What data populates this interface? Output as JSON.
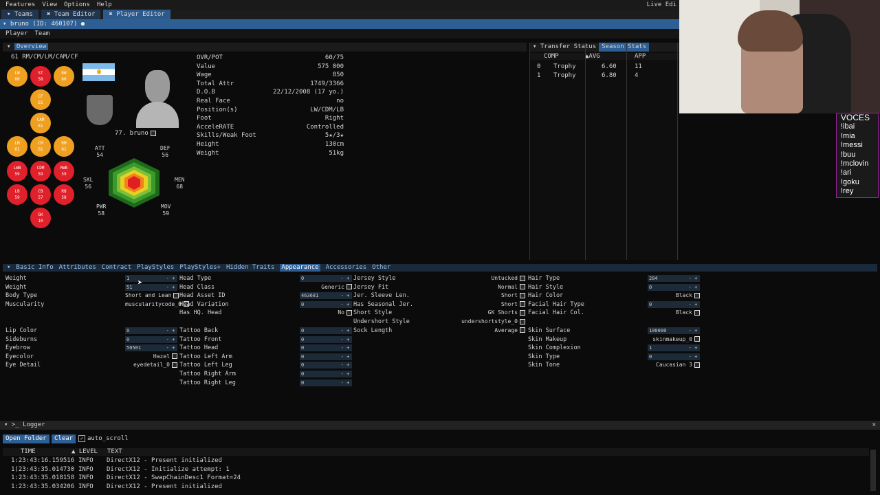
{
  "menu": [
    "Features",
    "View",
    "Options",
    "Help"
  ],
  "menu_right": "Live Edi",
  "tabs": [
    "Teams",
    "Team Editor",
    "Player Editor"
  ],
  "player_bar": "bruno (ID: 460107) ●",
  "subtabs": [
    "Player",
    "Team"
  ],
  "overview": {
    "title": "Overview",
    "positions_line": "61 RM/CM/LM/CAM/CF",
    "positions": [
      {
        "name": "LW",
        "val": "60",
        "color": "o"
      },
      {
        "name": "ST",
        "val": "58",
        "color": "r"
      },
      {
        "name": "RW",
        "val": "60",
        "color": "o"
      },
      {
        "name": "CF",
        "val": "61",
        "color": "o"
      },
      {
        "name": "CAM",
        "val": "61",
        "color": "o"
      },
      {
        "name": "LM",
        "val": "61",
        "color": "o"
      },
      {
        "name": "CM",
        "val": "61",
        "color": "o"
      },
      {
        "name": "RM",
        "val": "61",
        "color": "o"
      },
      {
        "name": "LWB",
        "val": "59",
        "color": "r"
      },
      {
        "name": "CDM",
        "val": "59",
        "color": "r"
      },
      {
        "name": "RWB",
        "val": "59",
        "color": "r"
      },
      {
        "name": "LB",
        "val": "59",
        "color": "r"
      },
      {
        "name": "CB",
        "val": "57",
        "color": "r"
      },
      {
        "name": "RB",
        "val": "58",
        "color": "r"
      },
      {
        "name": "GK",
        "val": "10",
        "color": "r"
      }
    ],
    "player_name": "77. bruno",
    "stats": {
      "att_l": "ATT",
      "att": "54",
      "def_l": "DEF",
      "def": "56",
      "skl_l": "SKL",
      "skl": "56",
      "men_l": "MEN",
      "men": "68",
      "pwr_l": "PWR",
      "pwr": "58",
      "mov_l": "MOV",
      "mov": "59"
    },
    "info": [
      [
        "OVR/POT",
        "60/75"
      ],
      [
        "Value",
        "575 000"
      ],
      [
        "Wage",
        "850"
      ],
      [
        "Total Attr",
        "1749/3366"
      ],
      [
        "D.O.B",
        "22/12/2008 (17 yo.)"
      ],
      [
        "Real Face",
        "no"
      ],
      [
        "Position(s)",
        "LW/CDM/LB"
      ],
      [
        "Foot",
        "Right"
      ],
      [
        "AcceleRATE",
        "Controlled"
      ],
      [
        "Skills/Weak Foot",
        "5★/3★"
      ],
      [
        "Height",
        "130cm"
      ],
      [
        "Weight",
        "51kg"
      ]
    ]
  },
  "transfer": {
    "tabs": [
      "Transfer Status",
      "Season Stats"
    ],
    "cols": [
      "COMP",
      "AVG",
      "APP"
    ],
    "rows": [
      [
        "0",
        "Trophy",
        "6.60",
        "11"
      ],
      [
        "1",
        "Trophy",
        "6.80",
        "4"
      ]
    ]
  },
  "editor_tabs": [
    "Basic Info",
    "Attributes",
    "Contract",
    "PlayStyles",
    "PlayStyles+",
    "Hidden Traits",
    "Appearance",
    "Accessories",
    "Other"
  ],
  "col1": [
    [
      "Weight",
      "1"
    ],
    [
      "Weight",
      "51"
    ],
    [
      "Body Type",
      "Short and Lean"
    ],
    [
      "Muscularity",
      "muscularitycode_0"
    ]
  ],
  "col1b": [
    [
      "Lip Color",
      "0"
    ],
    [
      "Sideburns",
      "0"
    ],
    [
      "Eyebrow",
      "50501"
    ],
    [
      "Eyecolor",
      "Hazel"
    ],
    [
      "Eye Detail",
      "eyedetail_0"
    ]
  ],
  "col2": [
    [
      "Head Type",
      "0"
    ],
    [
      "Head Class",
      "Generic"
    ],
    [
      "Head Asset ID",
      "463681"
    ],
    [
      "Head Variation",
      "0"
    ],
    [
      "Has HQ. Head",
      "No"
    ]
  ],
  "col2b": [
    [
      "Tattoo Back",
      "0"
    ],
    [
      "Tattoo Front",
      "0"
    ],
    [
      "Tattoo Head",
      "0"
    ],
    [
      "Tattoo Left Arm",
      "0"
    ],
    [
      "Tattoo Left Leg",
      "0"
    ],
    [
      "Tattoo Right Arm",
      "0"
    ],
    [
      "Tattoo Right Leg",
      "0"
    ]
  ],
  "col3": [
    [
      "Jersey Style",
      "Untucked"
    ],
    [
      "Jersey Fit",
      "Normal"
    ],
    [
      "Jer. Sleeve Len.",
      "Short"
    ],
    [
      "Has Seasonal Jer.",
      "Short"
    ],
    [
      "Short Style",
      "GK Shorts"
    ],
    [
      "Undershort Style",
      "undershortstyle_0"
    ],
    [
      "Sock Length",
      "Average"
    ]
  ],
  "col4": [
    [
      "Hair Type",
      "204"
    ],
    [
      "Hair Style",
      "0"
    ],
    [
      "Hair Color",
      "Black"
    ],
    [
      "Facial Hair Type",
      "0"
    ],
    [
      "Facial Hair Col.",
      "Black"
    ]
  ],
  "col4b": [
    [
      "Skin Surface",
      "100000"
    ],
    [
      "Skin Makeup",
      "skinmakeup_0"
    ],
    [
      "Skin Complexion",
      "1"
    ],
    [
      "Skin Type",
      "0"
    ],
    [
      "Skin Tone",
      "Caucasian 3"
    ]
  ],
  "logger": {
    "title": "Logger",
    "open": "Open Folder",
    "clear": "Clear",
    "auto": "auto_scroll",
    "cols": [
      "TIME",
      "LEVEL",
      "TEXT"
    ],
    "rows": [
      [
        "1:23:43:16.159516",
        "INFO",
        "DirectX12 - Present initialized"
      ],
      [
        "1(23:43:35.014730",
        "INFO",
        "DirectX12 - Initialize attempt: 1"
      ],
      [
        "1:23:43:35.018158",
        "INFO",
        "DirectX12 - SwapChainDesc1 Format=24"
      ],
      [
        "1:23:43:35.034206",
        "INFO",
        "DirectX12 - Present initialized"
      ]
    ]
  },
  "voces": {
    "title": "VOCES",
    "items": [
      "!ibai",
      "!mia",
      "!messi",
      "!buu",
      "!mclovin",
      "!ari",
      "!goku",
      "!rey"
    ]
  }
}
